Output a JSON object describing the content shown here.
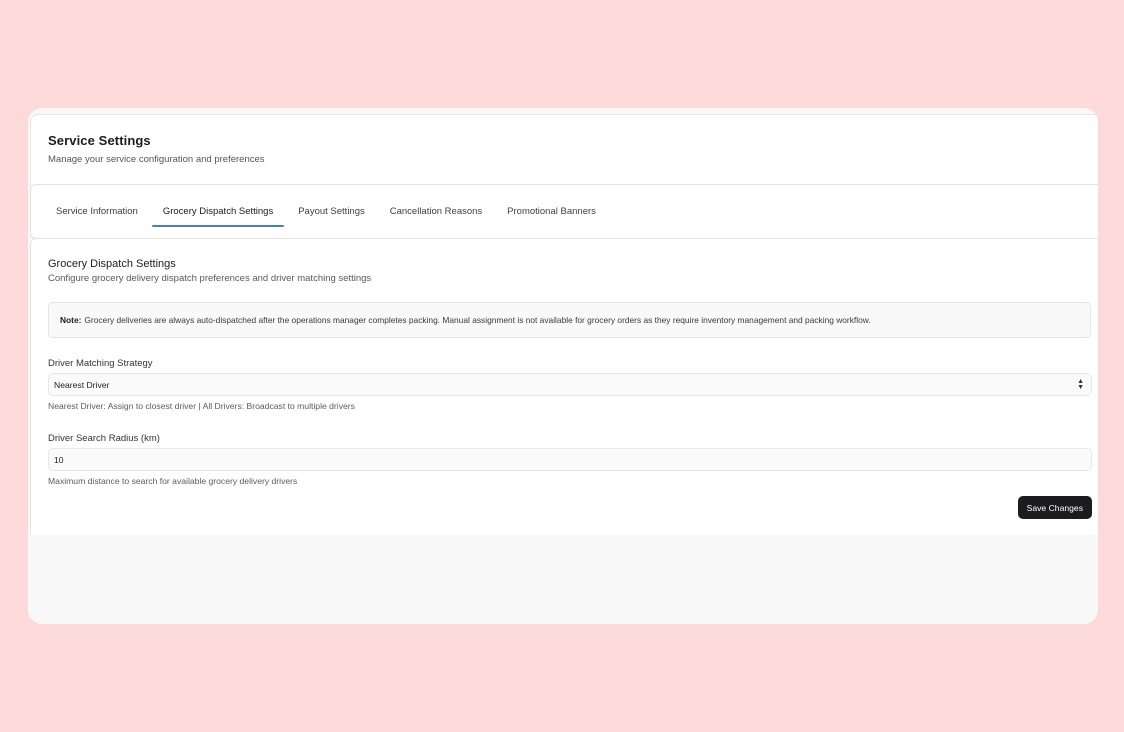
{
  "header": {
    "title": "Service Settings",
    "subtitle": "Manage your service configuration and preferences"
  },
  "tabs": [
    {
      "label": "Service Information",
      "active": false
    },
    {
      "label": "Grocery Dispatch Settings",
      "active": true
    },
    {
      "label": "Payout Settings",
      "active": false
    },
    {
      "label": "Cancellation Reasons",
      "active": false
    },
    {
      "label": "Promotional Banners",
      "active": false
    }
  ],
  "section": {
    "title": "Grocery Dispatch Settings",
    "subtitle": "Configure grocery delivery dispatch preferences and driver matching settings"
  },
  "note": {
    "prefix": "Note:",
    "text": "Grocery deliveries are always auto-dispatched after the operations manager completes packing. Manual assignment is not available for grocery orders as they require inventory management and packing workflow."
  },
  "matching": {
    "label": "Driver Matching Strategy",
    "selected": "Nearest Driver",
    "help": "Nearest Driver: Assign to closest driver | All Drivers: Broadcast to multiple drivers"
  },
  "radius": {
    "label": "Driver Search Radius (km)",
    "value": "10",
    "help": "Maximum distance to search for available grocery delivery drivers"
  },
  "actions": {
    "save_label": "Save Changes"
  },
  "colors": {
    "page_bg": "#fddada",
    "accent": "#4a78d6",
    "button_bg": "#1c1c1e"
  }
}
